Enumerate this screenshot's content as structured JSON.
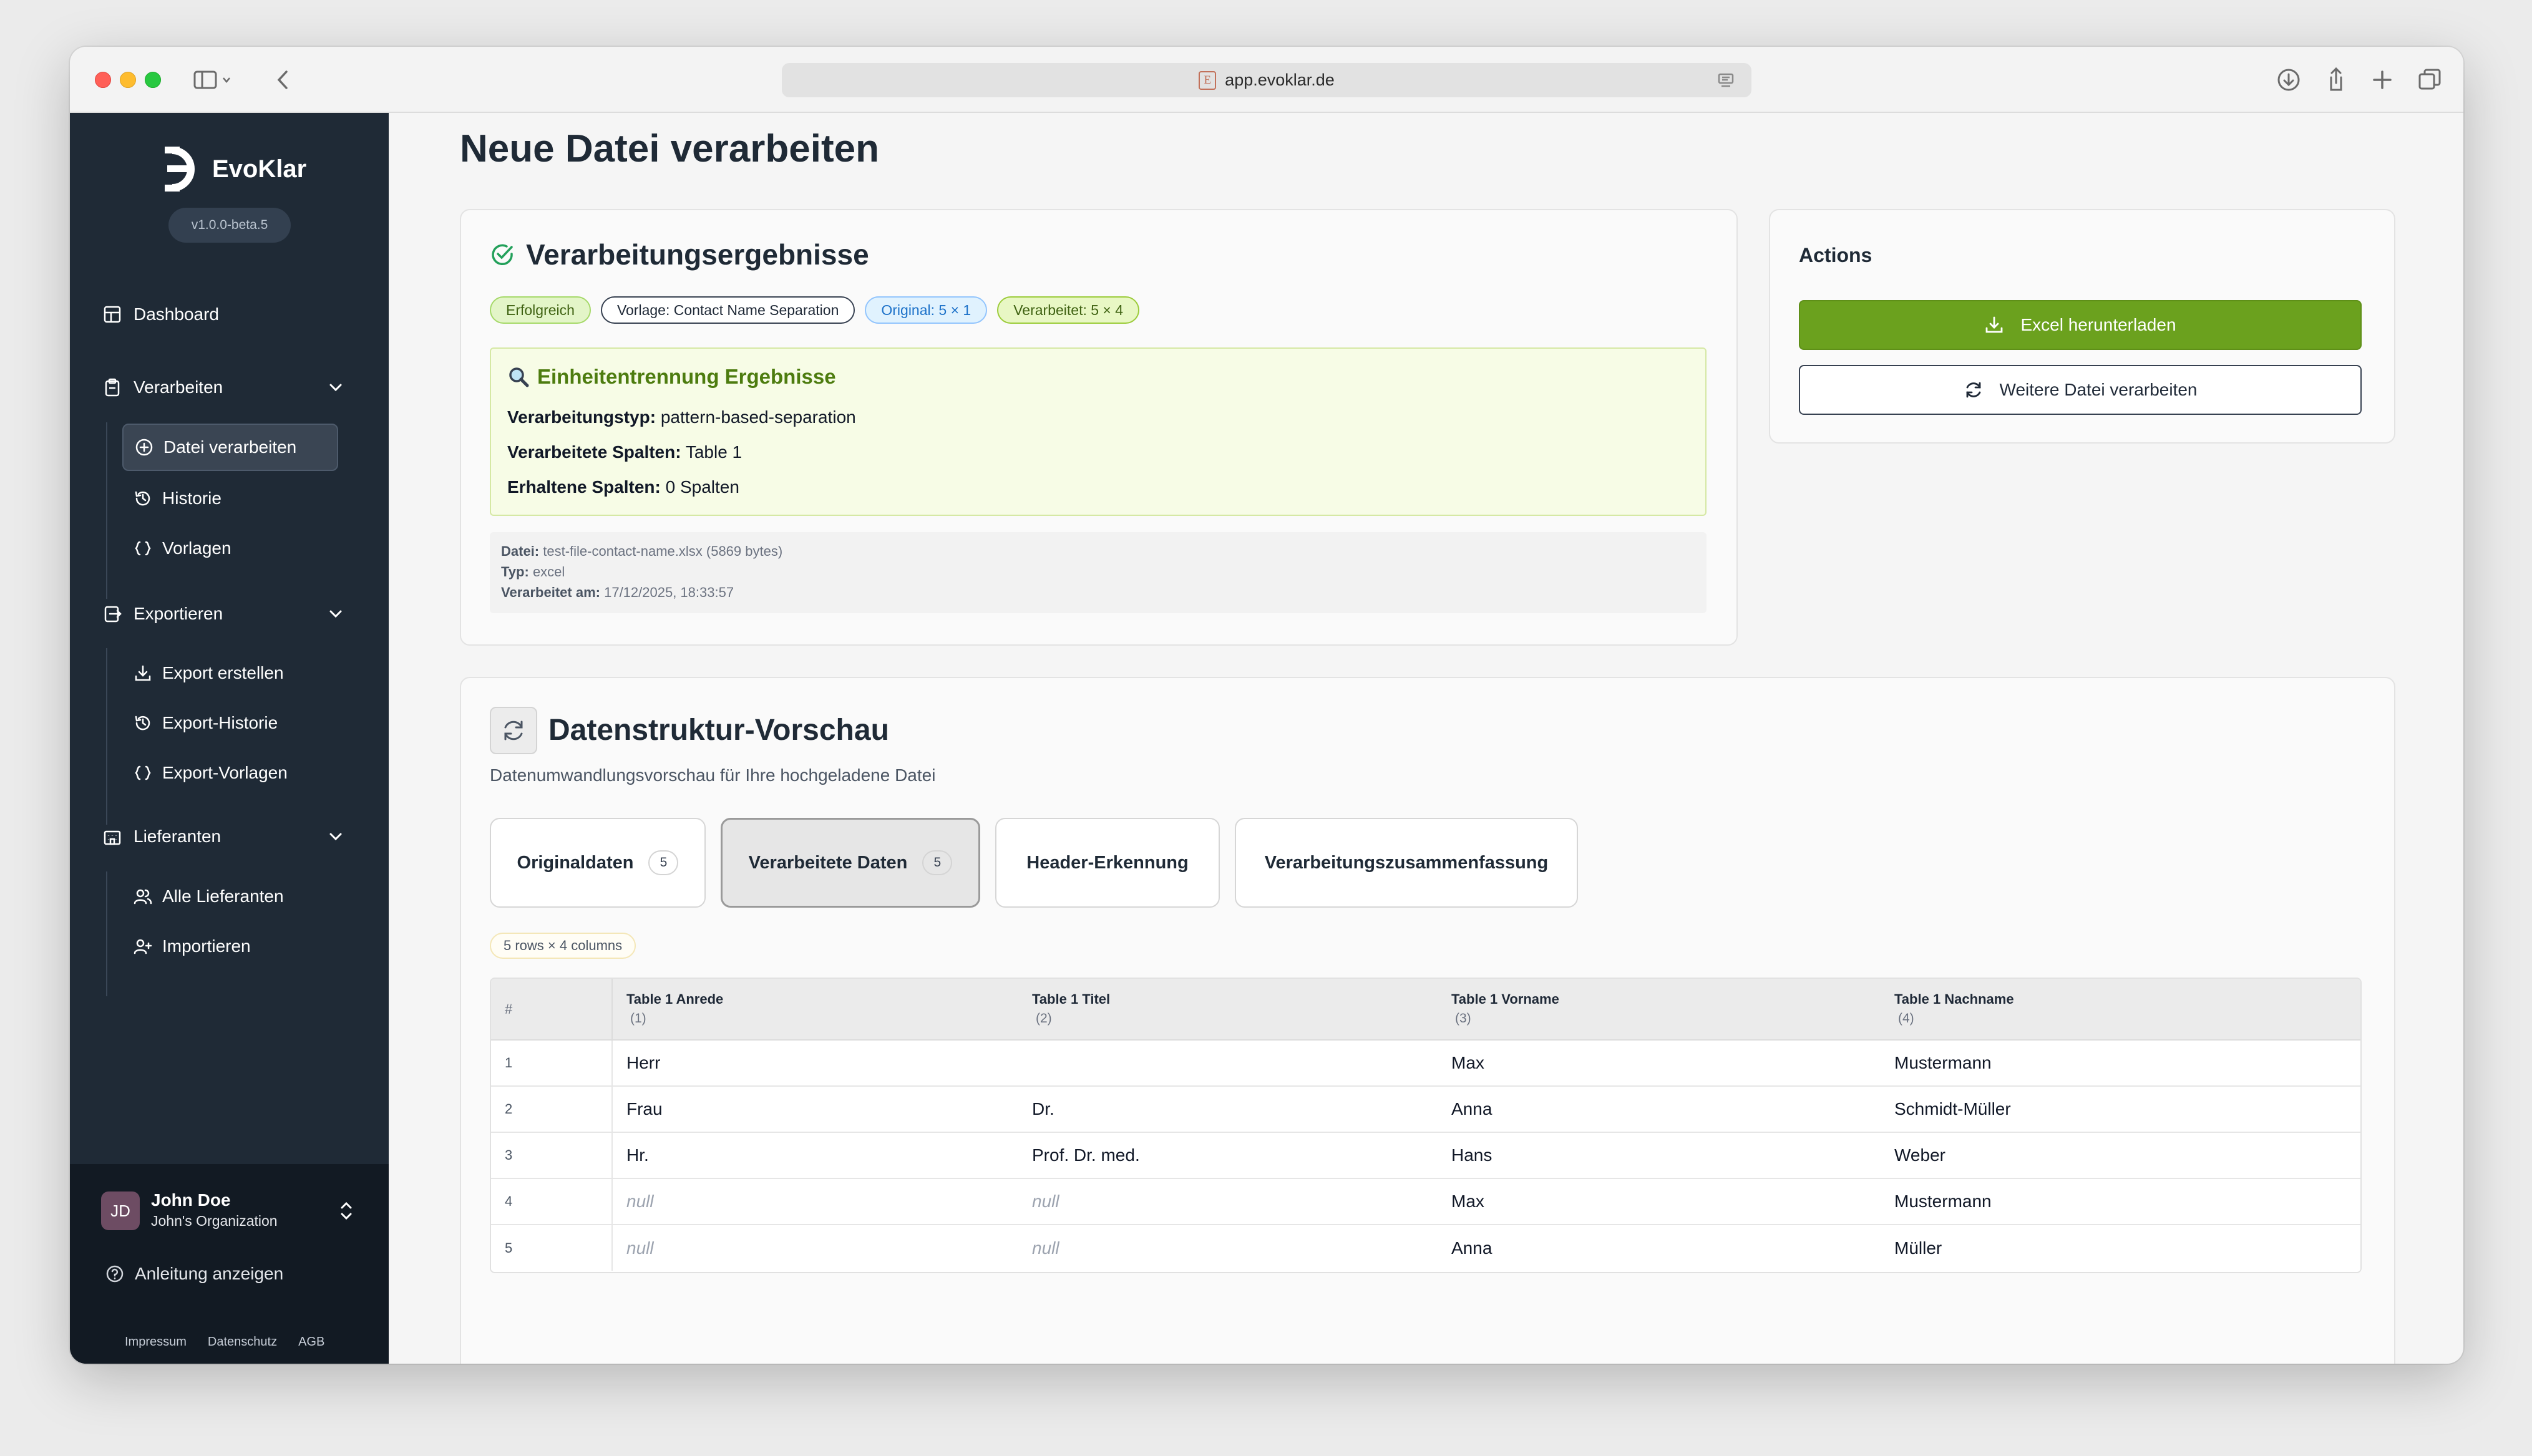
{
  "browser": {
    "url": "app.evoklar.de",
    "favicon_letter": "E"
  },
  "sidebar": {
    "logo_text": "EvoKlar",
    "version": "v1.0.0-beta.5",
    "nav": {
      "dashboard": "Dashboard",
      "verarbeiten": {
        "label": "Verarbeiten",
        "items": [
          "Datei verarbeiten",
          "Historie",
          "Vorlagen"
        ]
      },
      "exportieren": {
        "label": "Exportieren",
        "items": [
          "Export erstellen",
          "Export-Historie",
          "Export-Vorlagen"
        ]
      },
      "lieferanten": {
        "label": "Lieferanten",
        "items": [
          "Alle Lieferanten",
          "Importieren"
        ]
      }
    },
    "user": {
      "initials": "JD",
      "name": "John Doe",
      "organization": "John's Organization"
    },
    "help": "Anleitung anzeigen",
    "footer": [
      "Impressum",
      "Datenschutz",
      "AGB"
    ]
  },
  "page": {
    "title": "Neue Datei verarbeiten"
  },
  "results": {
    "title": "Verarbeitungsergebnisse",
    "badges": {
      "status": "Erfolgreich",
      "template": "Vorlage: Contact Name Separation",
      "original": "Original: 5 × 1",
      "processed": "Verarbeitet: 5 × 4"
    },
    "unit_separation": {
      "title": "Einheitentrennung Ergebnisse",
      "type_label": "Verarbeitungstyp:",
      "type_value": "pattern-based-separation",
      "processed_cols_label": "Verarbeitete Spalten:",
      "processed_cols_value": "Table 1",
      "kept_cols_label": "Erhaltene Spalten:",
      "kept_cols_value": "0 Spalten"
    },
    "file_meta": {
      "file_label": "Datei:",
      "file_value": "test-file-contact-name.xlsx (5869 bytes)",
      "type_label": "Typ:",
      "type_value": "excel",
      "processed_label": "Verarbeitet am:",
      "processed_value": "17/12/2025, 18:33:57"
    }
  },
  "actions": {
    "title": "Actions",
    "download": "Excel herunterladen",
    "process_another": "Weitere Datei verarbeiten"
  },
  "preview": {
    "title": "Datenstruktur-Vorschau",
    "subtitle": "Datenumwandlungsvorschau für Ihre hochgeladene Datei",
    "tabs": [
      {
        "label": "Originaldaten",
        "count": "5"
      },
      {
        "label": "Verarbeitete Daten",
        "count": "5"
      },
      {
        "label": "Header-Erkennung"
      },
      {
        "label": "Verarbeitungszusammenfassung"
      }
    ],
    "active_tab": 1,
    "dims": "5 rows × 4 columns",
    "table": {
      "index_header": "#",
      "columns": [
        {
          "name": "Table 1 Anrede",
          "idx": "(1)"
        },
        {
          "name": "Table 1 Titel",
          "idx": "(2)"
        },
        {
          "name": "Table 1 Vorname",
          "idx": "(3)"
        },
        {
          "name": "Table 1 Nachname",
          "idx": "(4)"
        }
      ],
      "rows": [
        {
          "n": "1",
          "cells": [
            "Herr",
            "",
            "Max",
            "Mustermann"
          ]
        },
        {
          "n": "2",
          "cells": [
            "Frau",
            "Dr.",
            "Anna",
            "Schmidt-Müller"
          ]
        },
        {
          "n": "3",
          "cells": [
            "Hr.",
            "Prof. Dr. med.",
            "Hans",
            "Weber"
          ]
        },
        {
          "n": "4",
          "cells": [
            "null",
            "null",
            "Max",
            "Mustermann"
          ]
        },
        {
          "n": "5",
          "cells": [
            "null",
            "null",
            "Anna",
            "Müller"
          ]
        }
      ]
    }
  },
  "colors": {
    "sidebar_bg": "#1f2a36",
    "primary_green": "#6ba11e",
    "success_icon": "#22a05a"
  }
}
